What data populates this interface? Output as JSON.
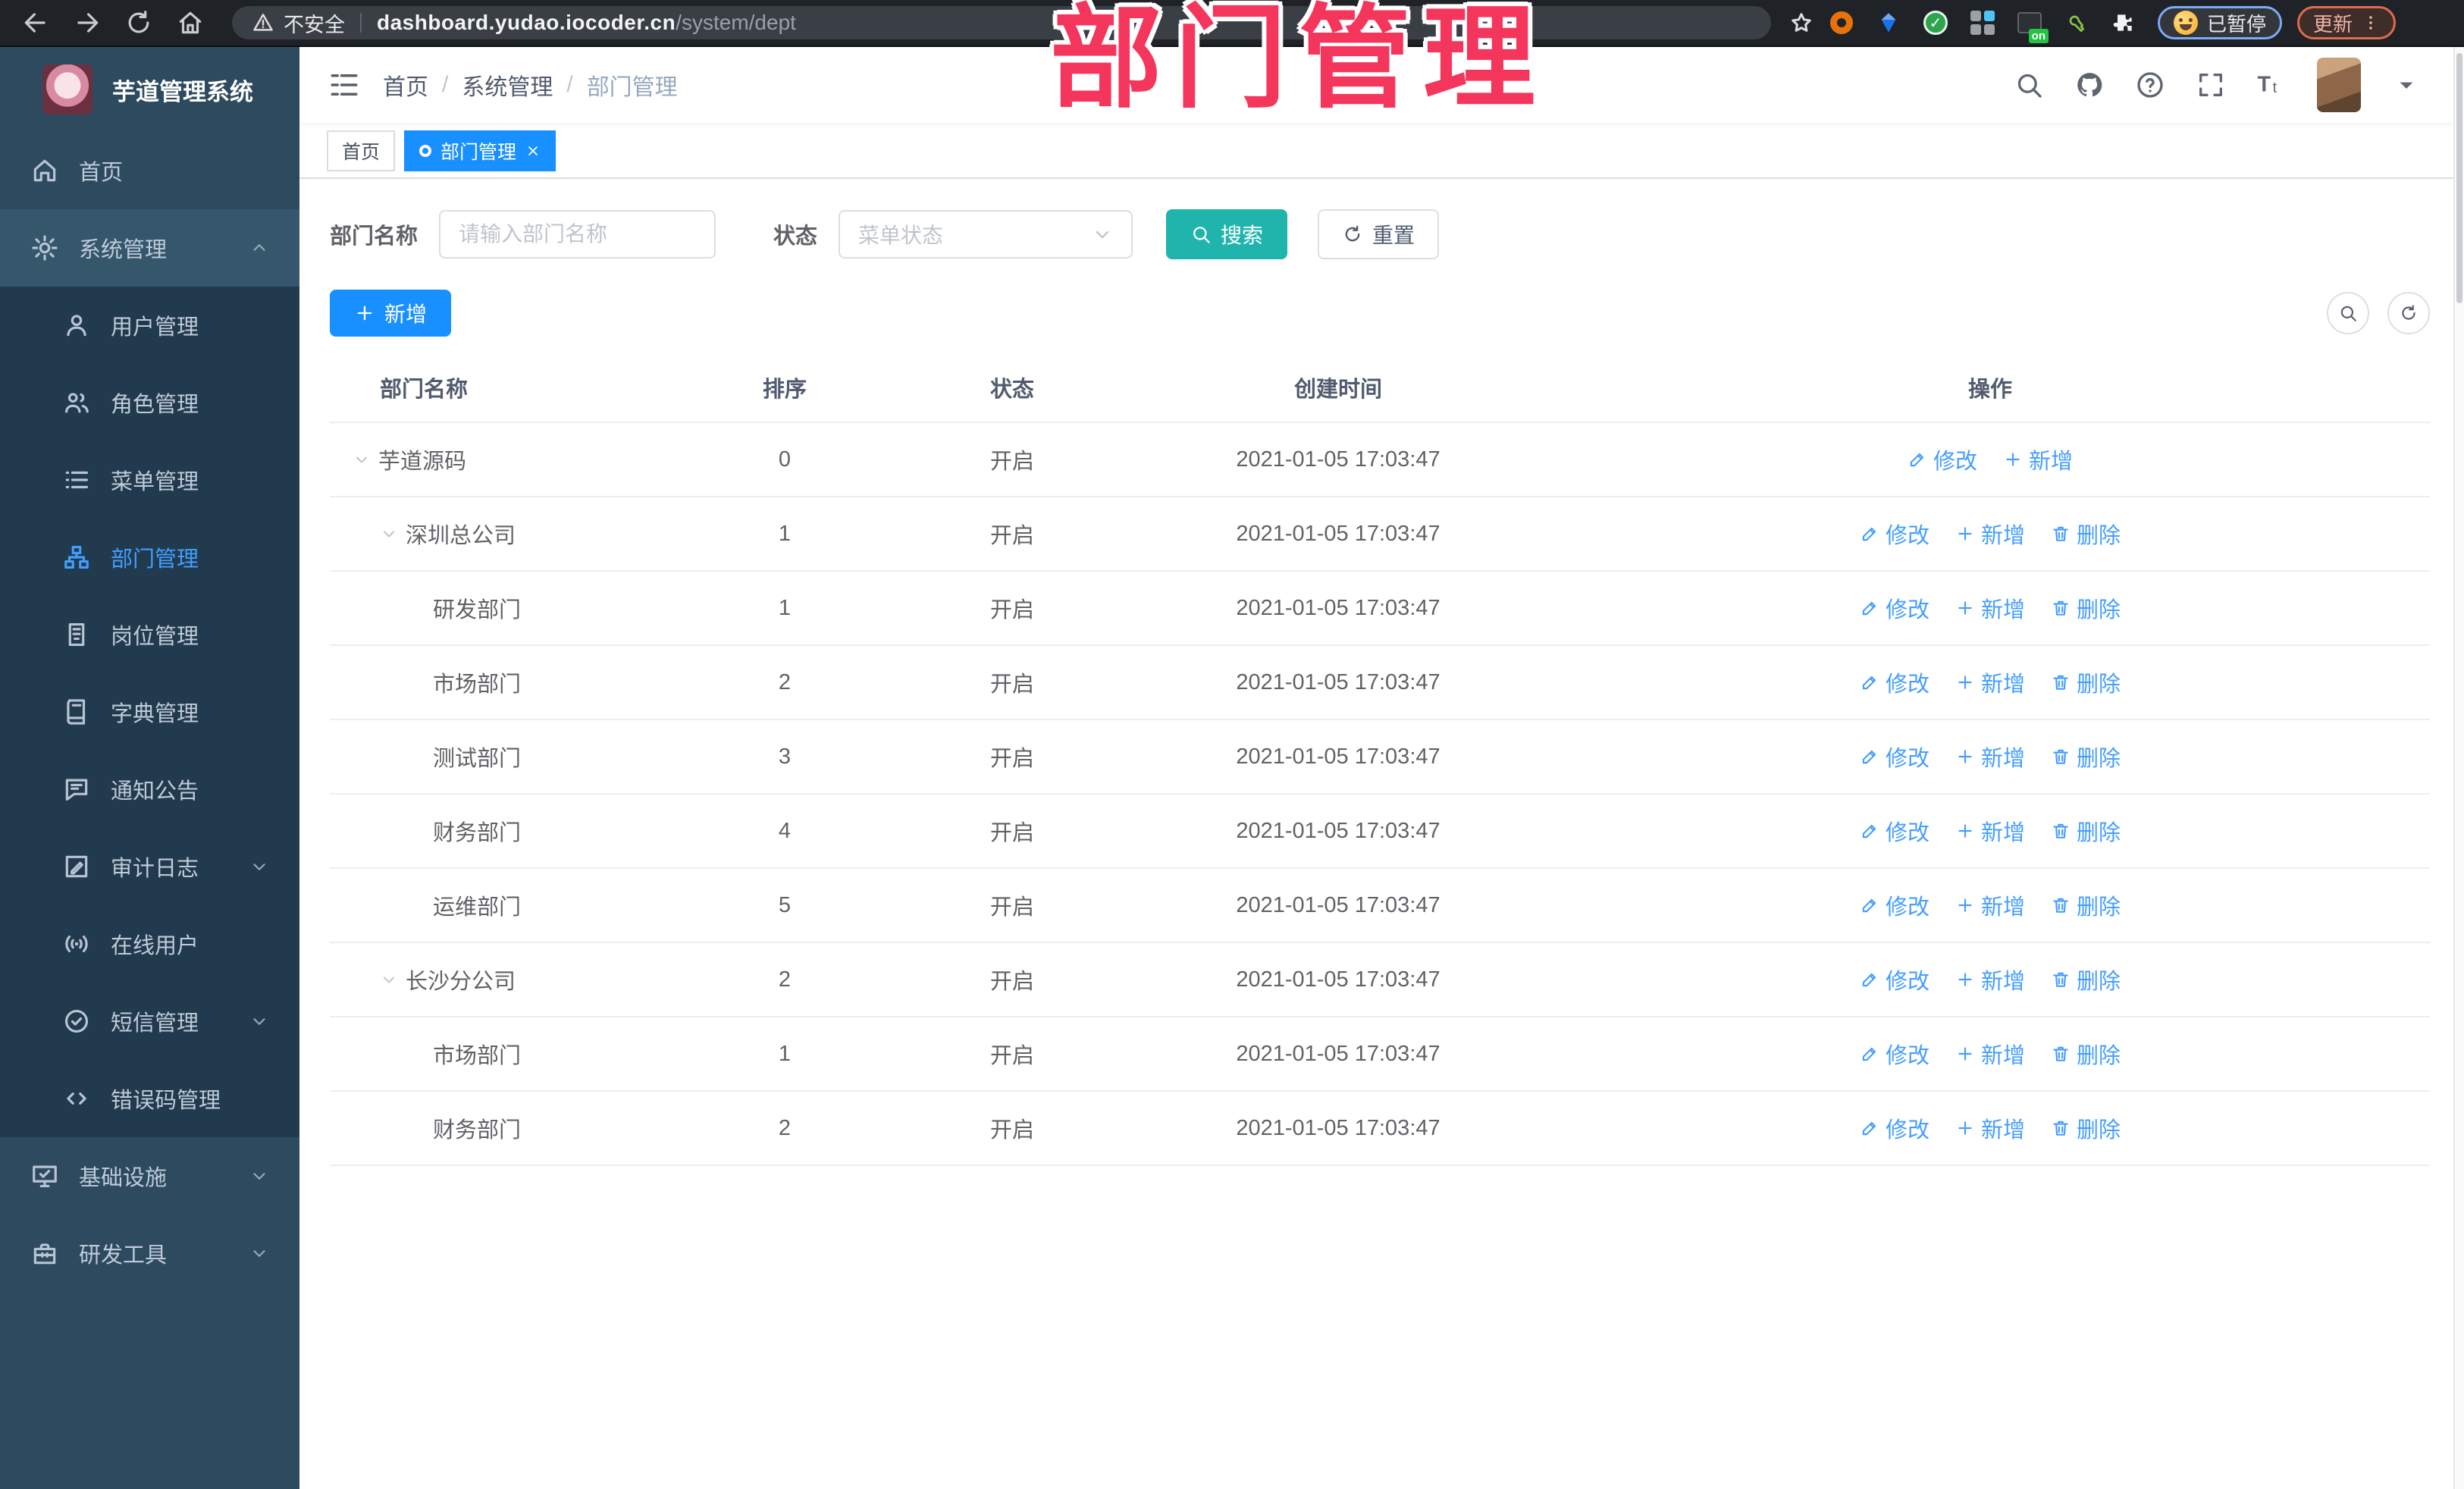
{
  "colors": {
    "accent_blue": "#1890ff",
    "active_menu_blue": "#409eff",
    "search_teal": "#1fb5ac",
    "overlay_pink": "#f5365c",
    "sidebar_bg": "#2d4a5f",
    "submenu_bg": "#223a4d"
  },
  "overlay": {
    "text": "部门管理"
  },
  "browser": {
    "nav_icons": [
      "back-icon",
      "forward-icon",
      "reload-icon",
      "home-icon"
    ],
    "security_label": "不安全",
    "url_host": "dashboard.yudao.iocoder.cn",
    "url_path": "/system/dept",
    "bookmark_icon": "star-icon",
    "extensions": [
      "ext-orange-ring-icon",
      "ext-blue-gem-icon",
      "ext-green-check-icon",
      "ext-squares-icon",
      "ext-dark-on-icon",
      "ext-green-key-icon",
      "ext-puzzle-icon"
    ],
    "paused_label": "已暂停",
    "update_label": "更新"
  },
  "sidebar": {
    "title": "芋道管理系统",
    "menu": [
      {
        "label": "首页",
        "icon": "home2-icon",
        "type": "top"
      },
      {
        "label": "系统管理",
        "icon": "gear-icon",
        "type": "top",
        "caret": "up",
        "open": true,
        "children": [
          {
            "label": "用户管理",
            "icon": "user-icon"
          },
          {
            "label": "角色管理",
            "icon": "users-icon"
          },
          {
            "label": "菜单管理",
            "icon": "list-icon"
          },
          {
            "label": "部门管理",
            "icon": "tree-icon",
            "active": true
          },
          {
            "label": "岗位管理",
            "icon": "badge-icon"
          },
          {
            "label": "字典管理",
            "icon": "book-icon"
          },
          {
            "label": "通知公告",
            "icon": "chat-icon"
          },
          {
            "label": "审计日志",
            "icon": "editlog-icon",
            "caret": "down"
          },
          {
            "label": "在线用户",
            "icon": "online-icon"
          },
          {
            "label": "短信管理",
            "icon": "sms-icon",
            "caret": "down"
          },
          {
            "label": "错误码管理",
            "icon": "code-icon"
          }
        ]
      },
      {
        "label": "基础设施",
        "icon": "monitor-icon",
        "type": "top",
        "caret": "down"
      },
      {
        "label": "研发工具",
        "icon": "toolbox-icon",
        "type": "top",
        "caret": "down"
      }
    ]
  },
  "header": {
    "breadcrumb": [
      "首页",
      "系统管理",
      "部门管理"
    ],
    "action_icons": [
      "search-icon",
      "github-icon",
      "help-icon",
      "fullscreen-icon",
      "fontsize-icon"
    ]
  },
  "tabs": [
    {
      "label": "首页",
      "active": false
    },
    {
      "label": "部门管理",
      "active": true,
      "closable": true
    }
  ],
  "filters": {
    "name_label": "部门名称",
    "name_placeholder": "请输入部门名称",
    "status_label": "状态",
    "status_placeholder": "菜单状态",
    "search_label": "搜索",
    "reset_label": "重置"
  },
  "toolbar": {
    "add_label": "新增"
  },
  "table": {
    "columns": [
      "部门名称",
      "排序",
      "状态",
      "创建时间",
      "操作"
    ],
    "op_icons": {
      "修改": "edit-icon",
      "新增": "plus-icon",
      "删除": "trash-icon"
    },
    "rows": [
      {
        "name": "芋道源码",
        "level": 0,
        "expandable": true,
        "order": "0",
        "status": "开启",
        "time": "2021-01-05 17:03:47",
        "ops": [
          "修改",
          "新增"
        ]
      },
      {
        "name": "深圳总公司",
        "level": 1,
        "expandable": true,
        "order": "1",
        "status": "开启",
        "time": "2021-01-05 17:03:47",
        "ops": [
          "修改",
          "新增",
          "删除"
        ]
      },
      {
        "name": "研发部门",
        "level": 2,
        "expandable": false,
        "order": "1",
        "status": "开启",
        "time": "2021-01-05 17:03:47",
        "ops": [
          "修改",
          "新增",
          "删除"
        ]
      },
      {
        "name": "市场部门",
        "level": 2,
        "expandable": false,
        "order": "2",
        "status": "开启",
        "time": "2021-01-05 17:03:47",
        "ops": [
          "修改",
          "新增",
          "删除"
        ]
      },
      {
        "name": "测试部门",
        "level": 2,
        "expandable": false,
        "order": "3",
        "status": "开启",
        "time": "2021-01-05 17:03:47",
        "ops": [
          "修改",
          "新增",
          "删除"
        ]
      },
      {
        "name": "财务部门",
        "level": 2,
        "expandable": false,
        "order": "4",
        "status": "开启",
        "time": "2021-01-05 17:03:47",
        "ops": [
          "修改",
          "新增",
          "删除"
        ]
      },
      {
        "name": "运维部门",
        "level": 2,
        "expandable": false,
        "order": "5",
        "status": "开启",
        "time": "2021-01-05 17:03:47",
        "ops": [
          "修改",
          "新增",
          "删除"
        ]
      },
      {
        "name": "长沙分公司",
        "level": 1,
        "expandable": true,
        "order": "2",
        "status": "开启",
        "time": "2021-01-05 17:03:47",
        "ops": [
          "修改",
          "新增",
          "删除"
        ]
      },
      {
        "name": "市场部门",
        "level": 2,
        "expandable": false,
        "order": "1",
        "status": "开启",
        "time": "2021-01-05 17:03:47",
        "ops": [
          "修改",
          "新增",
          "删除"
        ]
      },
      {
        "name": "财务部门",
        "level": 2,
        "expandable": false,
        "order": "2",
        "status": "开启",
        "time": "2021-01-05 17:03:47",
        "ops": [
          "修改",
          "新增",
          "删除"
        ]
      }
    ]
  }
}
